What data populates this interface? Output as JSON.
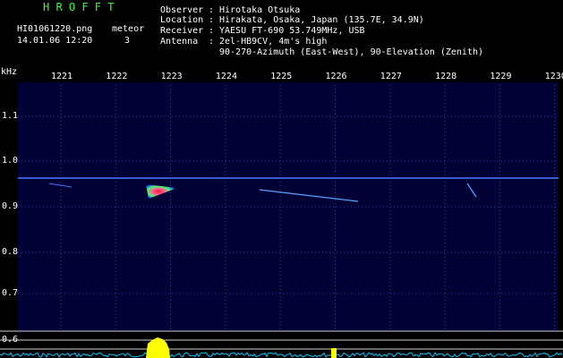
{
  "header": {
    "app_title": "H R O F F T",
    "filename": "HI01061220.png",
    "datetime": "14.01.06 12:20",
    "meteor_label": "meteor",
    "meteor_count": "3"
  },
  "info": {
    "observer_label": "Observer",
    "observer_value": "Hirotaka Otsuka",
    "location_label": "Location",
    "location_value": "Hirakata, Osaka, Japan (135.7E, 34.9N)",
    "receiver_label": "Receiver",
    "receiver_value": "YAESU FT-690 53.749MHz, USB",
    "antenna_label": "Antenna",
    "antenna_value_1": "2el-HB9CV, 4m's high",
    "antenna_value_2": "90-270-Azimuth (East-West), 90-Elevation (Zenith)",
    "sep": ":"
  },
  "axes": {
    "y_unit": "kHz",
    "time_ticks": [
      "1221",
      "1222",
      "1223",
      "1224",
      "1225",
      "1226",
      "1227",
      "1228",
      "1229",
      "1230"
    ],
    "freq_ticks": [
      "1.1",
      "1.0",
      "0.9",
      "0.8",
      "0.7",
      "0.6"
    ]
  },
  "colors": {
    "background": "#000000",
    "plot_background": "#000035",
    "title_green": "#33ff33",
    "carrier_line": "#3a5bd6",
    "meteor_hot": "#ff3030",
    "signal_trace": "#00c8ff",
    "peak_yellow": "#ffff00"
  }
}
